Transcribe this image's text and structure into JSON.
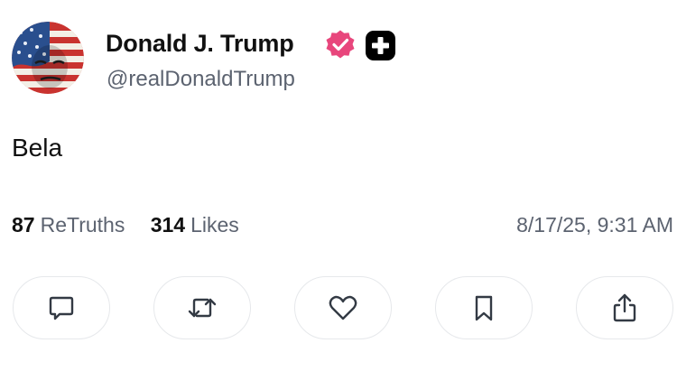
{
  "post": {
    "display_name": "Donald J. Trump",
    "handle": "@realDonaldTrump",
    "text": "Bela",
    "verified_color": "#e8467c",
    "badge_color": "#000000"
  },
  "stats": {
    "retruths_count": "87",
    "retruths_label": "ReTruths",
    "likes_count": "314",
    "likes_label": "Likes"
  },
  "timestamp": "8/17/25, 9:31 AM",
  "actions": [
    {
      "name": "reply",
      "icon": "comment-icon"
    },
    {
      "name": "retruth",
      "icon": "repost-icon"
    },
    {
      "name": "like",
      "icon": "heart-icon"
    },
    {
      "name": "bookmark",
      "icon": "bookmark-icon"
    },
    {
      "name": "share",
      "icon": "share-icon"
    }
  ]
}
